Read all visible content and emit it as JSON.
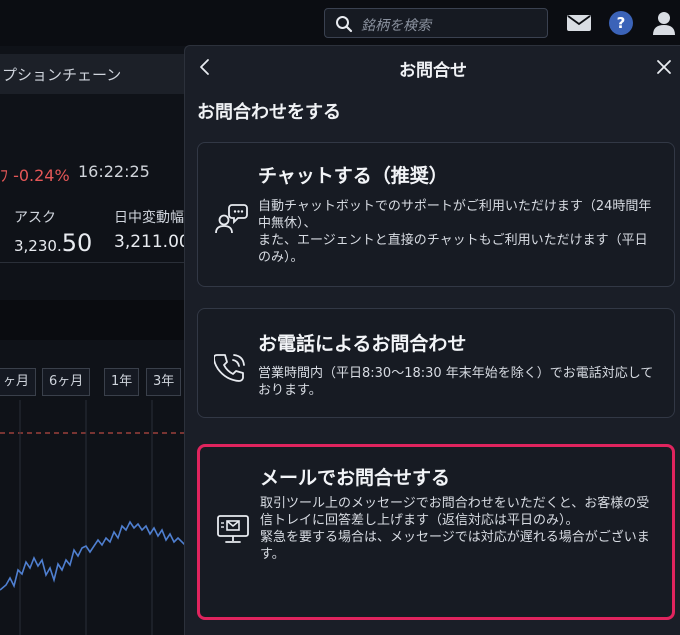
{
  "topbar": {
    "search_placeholder": "銘柄を検索",
    "icons": [
      "search-icon",
      "mail-icon",
      "help-icon",
      "user-icon"
    ],
    "help_glyph": "?"
  },
  "background": {
    "panel_title": "プションチェーン",
    "change": "ﾌ -0.24%",
    "time": "16:22:25",
    "ask_label": "アスク",
    "ask_value_prefix": "3,230.",
    "ask_value_suffix": "50",
    "range_label": "日中変動幅",
    "range_value": "3,211.00",
    "period_tabs": [
      "ヶ月",
      "6ヶ月",
      "1年",
      "3年"
    ]
  },
  "modal": {
    "title": "お問合せ",
    "section_title": "お問合わせをする",
    "cards": [
      {
        "title": "チャットする（推奨）",
        "description": "自動チャットボットでのサポートがご利用いただけます（24時間年中無休）、\nまた、エージェントと直接のチャットもご利用いただけます（平日のみ）。",
        "icon": "chat-support-icon"
      },
      {
        "title": "お電話によるお問合わせ",
        "description": "営業時間内（平日8:30〜18:30 年末年始を除く）でお電話対応しております。",
        "icon": "phone-icon"
      },
      {
        "title": "メールでお問合せする",
        "description": "取引ツール上のメッセージでお問合わせをいただくと、お客様の受信トレイに回答差し上げます（返信対応は平日のみ）。\n緊急を要する場合は、メッセージでは対応が遅れる場合がございます。",
        "icon": "mail-monitor-icon",
        "highlighted": true
      }
    ]
  },
  "colors": {
    "highlight": "#e0245e",
    "negative": "#e45757",
    "chart_line": "#4f7fd0",
    "accent_help": "#3b63b8"
  }
}
